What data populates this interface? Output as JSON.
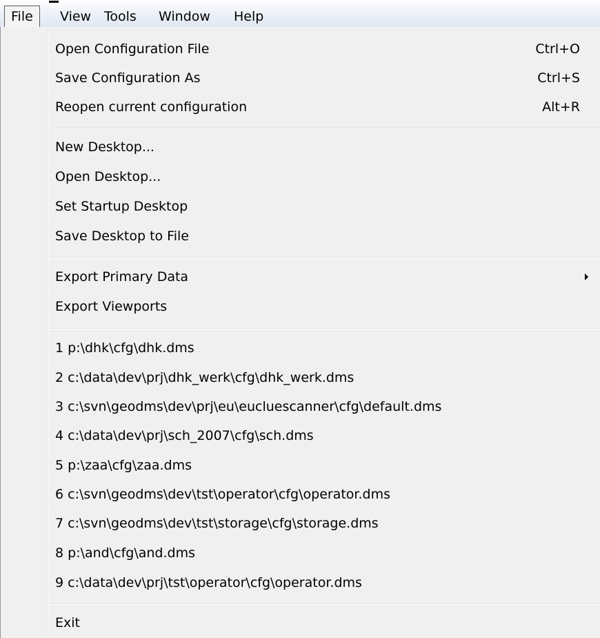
{
  "menubar": {
    "items": [
      {
        "label": "File"
      },
      {
        "label": "View"
      },
      {
        "label": "Tools"
      },
      {
        "label": "Window"
      },
      {
        "label": "Help"
      }
    ]
  },
  "file_menu": {
    "configuration": [
      {
        "label": "Open Configuration File",
        "shortcut": "Ctrl+O"
      },
      {
        "label": "Save Configuration As",
        "shortcut": "Ctrl+S"
      },
      {
        "label": "Reopen current configuration",
        "shortcut": "Alt+R"
      }
    ],
    "desktop": [
      {
        "label": "New Desktop..."
      },
      {
        "label": "Open Desktop..."
      },
      {
        "label": "Set Startup Desktop"
      },
      {
        "label": "Save Desktop to File"
      }
    ],
    "export": [
      {
        "label": "Export Primary Data",
        "has_submenu": true
      },
      {
        "label": "Export Viewports"
      }
    ],
    "recent_files": [
      "1 p:\\dhk\\cfg\\dhk.dms",
      "2 c:\\data\\dev\\prj\\dhk_werk\\cfg\\dhk_werk.dms",
      "3 c:\\svn\\geodms\\dev\\prj\\eu\\eucluescanner\\cfg\\default.dms",
      "4 c:\\data\\dev\\prj\\sch_2007\\cfg\\sch.dms",
      "5 p:\\zaa\\cfg\\zaa.dms",
      "6 c:\\svn\\geodms\\dev\\tst\\operator\\cfg\\operator.dms",
      "7 c:\\svn\\geodms\\dev\\tst\\storage\\cfg\\storage.dms",
      "8 p:\\and\\cfg\\and.dms",
      "9 c:\\data\\dev\\prj\\tst\\operator\\cfg\\operator.dms"
    ],
    "exit": {
      "label": "Exit"
    }
  }
}
